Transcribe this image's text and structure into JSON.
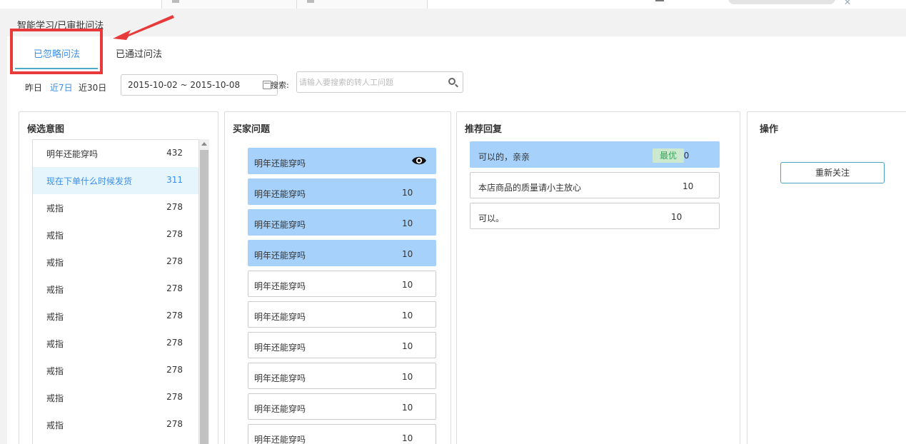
{
  "breadcrumb": "智能学习/已审批问法",
  "tabs": [
    {
      "label": "已忽略问法",
      "active": true
    },
    {
      "label": "已通过问法",
      "active": false
    }
  ],
  "filters": {
    "ranges": [
      "昨日",
      "近7日",
      "近30日"
    ],
    "active_range": "近7日",
    "date_range": "2015-10-02 ~ 2015-10-08",
    "search_label": "搜索:",
    "search_placeholder": "请输入要搜索的转人工问题"
  },
  "panels": {
    "candidates": {
      "title": "候选意图",
      "items": [
        {
          "text": "明年还能穿吗",
          "count": "432"
        },
        {
          "text": "现在下单什么时候发货",
          "count": "311",
          "selected": true
        },
        {
          "text": "戒指",
          "count": "278"
        },
        {
          "text": "戒指",
          "count": "278"
        },
        {
          "text": "戒指",
          "count": "278"
        },
        {
          "text": "戒指",
          "count": "278"
        },
        {
          "text": "戒指",
          "count": "278"
        },
        {
          "text": "戒指",
          "count": "278"
        },
        {
          "text": "戒指",
          "count": "278"
        },
        {
          "text": "戒指",
          "count": "278"
        },
        {
          "text": "戒指",
          "count": "278"
        }
      ]
    },
    "buyer_questions": {
      "title": "买家问题",
      "items": [
        {
          "text": "明年还能穿吗",
          "count": "",
          "highlight": true,
          "icon": "eye-icon"
        },
        {
          "text": "明年还能穿吗",
          "count": "10",
          "highlight": true
        },
        {
          "text": "明年还能穿吗",
          "count": "10",
          "highlight": true
        },
        {
          "text": "明年还能穿吗",
          "count": "10",
          "highlight": true
        },
        {
          "text": "明年还能穿吗",
          "count": "10",
          "highlight": false
        },
        {
          "text": "明年还能穿吗",
          "count": "10",
          "highlight": false
        },
        {
          "text": "明年还能穿吗",
          "count": "10",
          "highlight": false
        },
        {
          "text": "明年还能穿吗",
          "count": "10",
          "highlight": false
        },
        {
          "text": "明年还能穿吗",
          "count": "10",
          "highlight": false
        },
        {
          "text": "明年还能穿吗",
          "count": "10",
          "highlight": false
        }
      ]
    },
    "recommended": {
      "title": "推荐回复",
      "best_label": "最优",
      "items": [
        {
          "text": "可以的，亲亲",
          "count": "10",
          "highlight": true,
          "best": true
        },
        {
          "text": "本店商品的质量请小主放心",
          "count": "10",
          "highlight": false
        },
        {
          "text": "可以。",
          "count": "10",
          "highlight": false
        }
      ]
    },
    "actions": {
      "title": "操作",
      "refocus_label": "重新关注"
    }
  },
  "colors": {
    "accent": "#3a8ee6",
    "highlight_blue": "#a6d1fb",
    "annotation_red": "#e83a3a",
    "best_green": "#3aa55a"
  }
}
